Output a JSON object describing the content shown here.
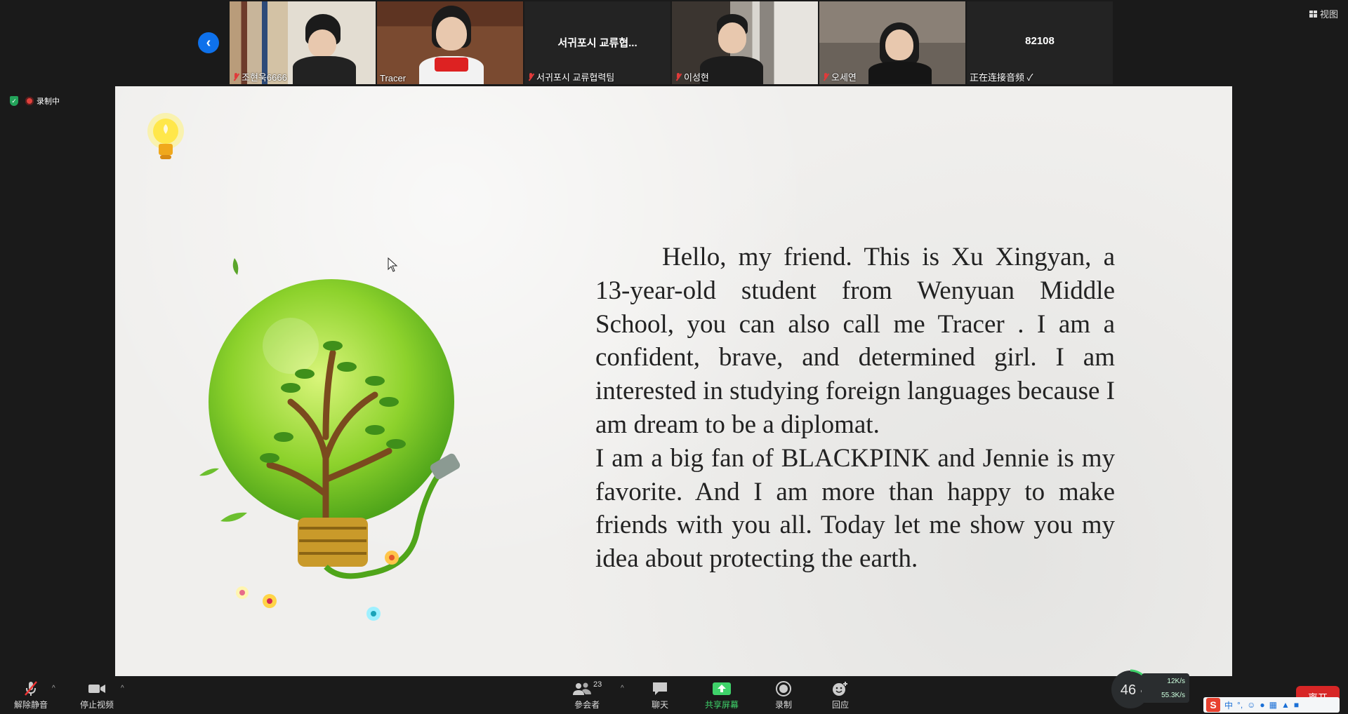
{
  "top_bar": {
    "view_label": "视图",
    "participants": [
      {
        "name": "조현욱6666",
        "muted": true,
        "video": true,
        "active": false
      },
      {
        "name": "Tracer",
        "muted": false,
        "video": true,
        "active": true
      },
      {
        "name": "서귀포시 교류협력팀",
        "muted": true,
        "video": false,
        "center_text": "서귀포시 교류협...",
        "active": false
      },
      {
        "name": "이성현",
        "muted": true,
        "video": true,
        "active": false
      },
      {
        "name": "오세연",
        "muted": true,
        "video": true,
        "active": false
      },
      {
        "name": "正在连接音频 ✓",
        "muted": false,
        "video": false,
        "center_text": "82108",
        "active": false
      }
    ]
  },
  "status": {
    "recording_label": "录制中"
  },
  "slide": {
    "paragraph1": "Hello, my friend. This is Xu Xingyan, a 13-year-old student from Wenyuan Middle School, you can also call me Tracer . I am a confident, brave, and determined girl. I am interested in studying foreign languages because I am dream to be a diplomat.",
    "paragraph2": "I am a big fan of BLACKPINK and Jennie is my favorite. And I am more than happy to make friends with you all. Today let me show you my idea about protecting the earth."
  },
  "toolbar": {
    "unmute_label": "解除静音",
    "stop_video_label": "停止视频",
    "participants_label": "參会者",
    "participants_count": "23",
    "chat_label": "聊天",
    "share_label": "共享屏幕",
    "record_label": "录制",
    "reaction_label": "回应",
    "leave_label": "离开"
  },
  "net_meter": {
    "percent": "46",
    "percent_unit": "%",
    "upload": "12K/s",
    "download": "55.3K/s"
  },
  "ime": {
    "logo": "S",
    "mode": "中"
  },
  "colors": {
    "accent_blue": "#0e71eb",
    "share_green": "#3fd26a",
    "leave_red": "#d72626",
    "active_border": "#6ba84a"
  }
}
